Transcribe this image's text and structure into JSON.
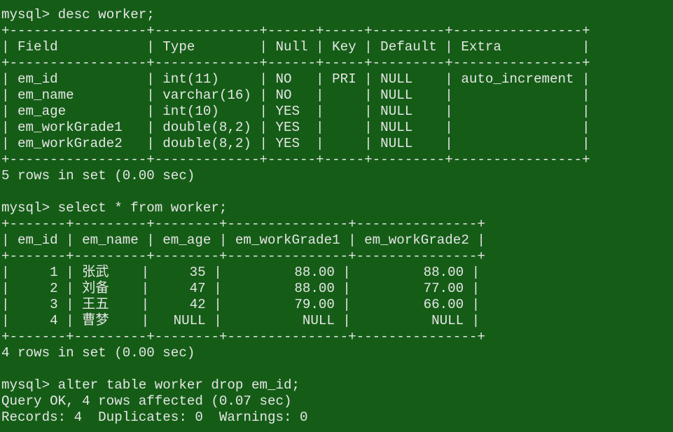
{
  "terminal": {
    "lines": [
      {
        "kind": "command",
        "prompt": "mysql> ",
        "text": "desc worker;"
      },
      {
        "kind": "output",
        "text": "+-----------------+-------------+------+-----+---------+----------------+"
      },
      {
        "kind": "output",
        "text": "| Field           | Type        | Null | Key | Default | Extra          |"
      },
      {
        "kind": "output",
        "text": "+-----------------+-------------+------+-----+---------+----------------+"
      },
      {
        "kind": "output",
        "text": "| em_id           | int(11)     | NO   | PRI | NULL    | auto_increment |"
      },
      {
        "kind": "output",
        "text": "| em_name         | varchar(16) | NO   |     | NULL    |                |"
      },
      {
        "kind": "output",
        "text": "| em_age          | int(10)     | YES  |     | NULL    |                |"
      },
      {
        "kind": "output",
        "text": "| em_workGrade1   | double(8,2) | YES  |     | NULL    |                |"
      },
      {
        "kind": "output",
        "text": "| em_workGrade2   | double(8,2) | YES  |     | NULL    |                |"
      },
      {
        "kind": "output",
        "text": "+-----------------+-------------+------+-----+---------+----------------+"
      },
      {
        "kind": "output",
        "text": "5 rows in set (0.00 sec)"
      },
      {
        "kind": "output",
        "text": ""
      },
      {
        "kind": "command",
        "prompt": "mysql> ",
        "text": "select * from worker;"
      },
      {
        "kind": "output",
        "text": "+-------+---------+--------+---------------+---------------+"
      },
      {
        "kind": "output",
        "text": "| em_id | em_name | em_age | em_workGrade1 | em_workGrade2 |"
      },
      {
        "kind": "output",
        "text": "+-------+---------+--------+---------------+---------------+"
      },
      {
        "kind": "output",
        "text": "|     1 | 张武    |     35 |         88.00 |         88.00 |"
      },
      {
        "kind": "output",
        "text": "|     2 | 刘备    |     47 |         88.00 |         77.00 |"
      },
      {
        "kind": "output",
        "text": "|     3 | 王五    |     42 |         79.00 |         66.00 |"
      },
      {
        "kind": "output",
        "text": "|     4 | 曹梦    |   NULL |          NULL |          NULL |"
      },
      {
        "kind": "output",
        "text": "+-------+---------+--------+---------------+---------------+"
      },
      {
        "kind": "output",
        "text": "4 rows in set (0.00 sec)"
      },
      {
        "kind": "output",
        "text": ""
      },
      {
        "kind": "command",
        "prompt": "mysql> ",
        "text": "alter table worker drop em_id;"
      },
      {
        "kind": "output",
        "text": "Query OK, 4 rows affected (0.07 sec)"
      },
      {
        "kind": "output",
        "text": "Records: 4  Duplicates: 0  Warnings: 0"
      }
    ]
  },
  "colors": {
    "background": "#155d17",
    "foreground": "#e6e6e6"
  }
}
